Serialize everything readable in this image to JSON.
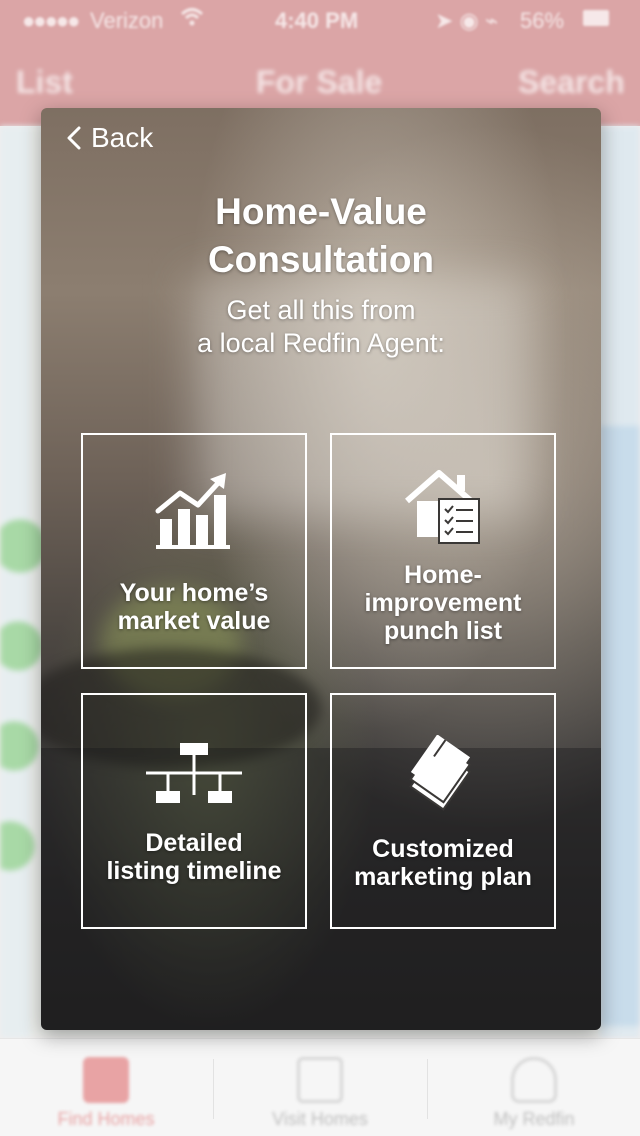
{
  "status_bar": {
    "signal": "●●●●●",
    "carrier": "Verizon",
    "time": "4:40 PM",
    "battery": "56%"
  },
  "background_nav": {
    "left": "List",
    "center": "For Sale",
    "right": "Search"
  },
  "tab_bar": {
    "tabs": [
      {
        "label": "Find Homes",
        "icon": "find-homes-icon",
        "active": true
      },
      {
        "label": "Visit Homes",
        "icon": "visit-homes-icon",
        "active": false
      },
      {
        "label": "My Redfin",
        "icon": "my-redfin-icon",
        "active": false
      }
    ]
  },
  "modal": {
    "back_label": "Back",
    "title_line1": "Home-Value",
    "title_line2": "Consultation",
    "subtitle_line1": "Get all this from",
    "subtitle_line2": "a local Redfin Agent:",
    "tiles": [
      {
        "label": "Your home’s\nmarket value",
        "icon": "chart-growth-icon"
      },
      {
        "label": "Home-\nimprovement\npunch list",
        "icon": "house-checklist-icon"
      },
      {
        "label": "Detailed\nlisting timeline",
        "icon": "timeline-hierarchy-icon"
      },
      {
        "label": "Customized\nmarketing plan",
        "icon": "documents-icon"
      }
    ]
  },
  "colors": {
    "brand_red": "#dba5a6",
    "tile_border": "#ffffff",
    "text": "#ffffff"
  }
}
